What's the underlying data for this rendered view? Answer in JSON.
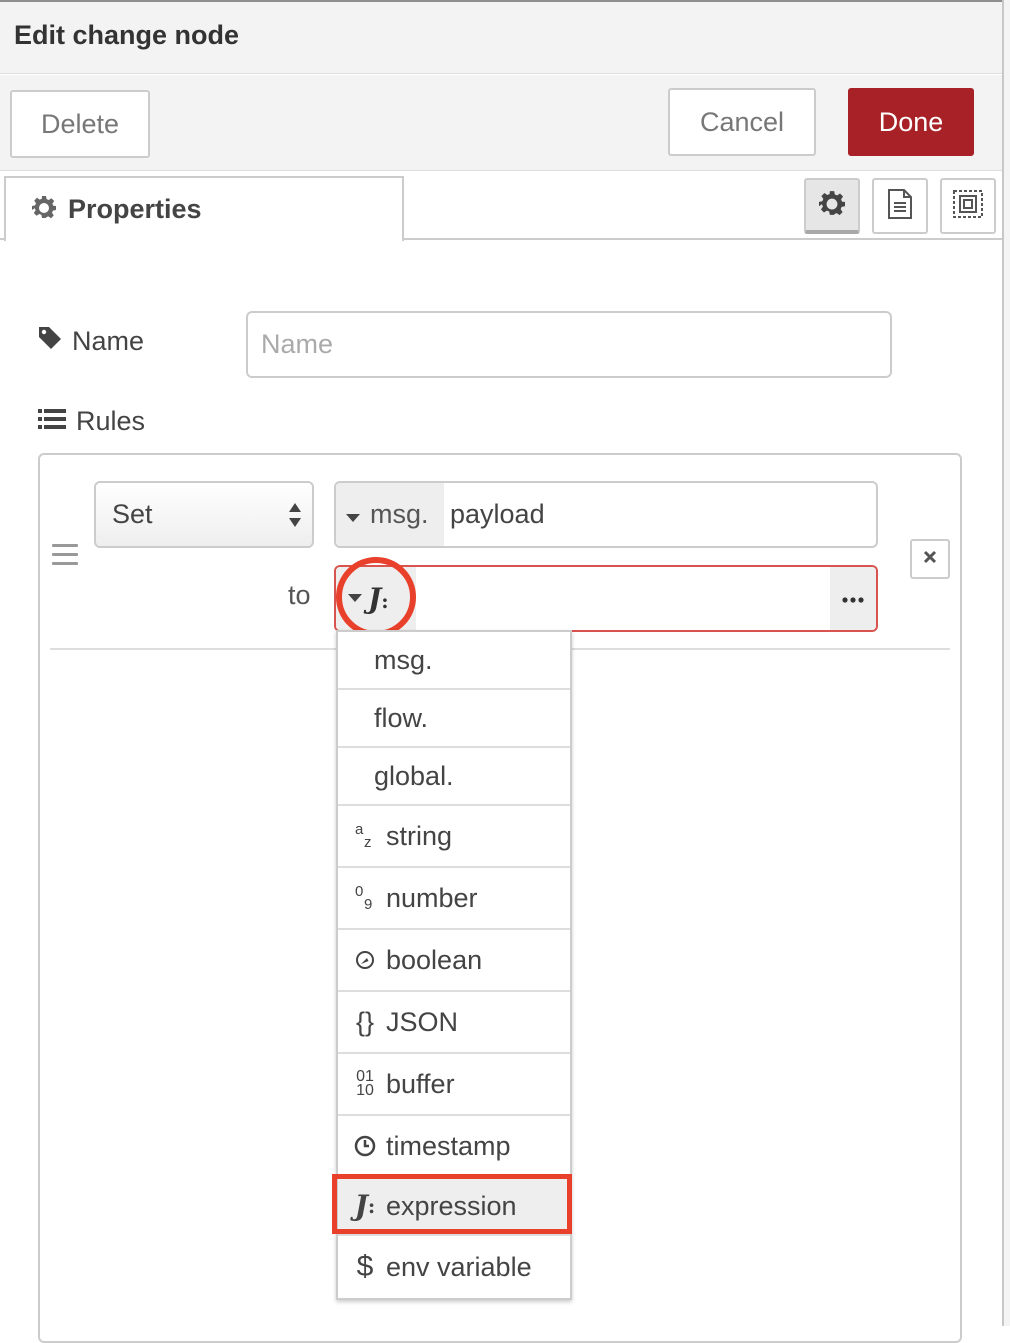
{
  "header": {
    "title": "Edit change node"
  },
  "toolbar": {
    "delete_label": "Delete",
    "cancel_label": "Cancel",
    "done_label": "Done"
  },
  "tabs": {
    "properties_label": "Properties"
  },
  "form": {
    "name_label": "Name",
    "name_placeholder": "Name",
    "name_value": "",
    "rules_label": "Rules"
  },
  "rule": {
    "action": "Set",
    "target_type": "msg.",
    "target_value": "payload",
    "to_label": "to",
    "to_value": ""
  },
  "dropdown": {
    "items": [
      {
        "label": "msg.",
        "icon": ""
      },
      {
        "label": "flow.",
        "icon": ""
      },
      {
        "label": "global.",
        "icon": ""
      },
      {
        "label": "string",
        "icon": "string-icon"
      },
      {
        "label": "number",
        "icon": "number-icon"
      },
      {
        "label": "boolean",
        "icon": "boolean-icon"
      },
      {
        "label": "JSON",
        "icon": "json-icon"
      },
      {
        "label": "buffer",
        "icon": "buffer-icon"
      },
      {
        "label": "timestamp",
        "icon": "clock-icon"
      },
      {
        "label": "expression",
        "icon": "jsonata-icon",
        "selected": true
      },
      {
        "label": "env variable",
        "icon": "dollar-icon"
      }
    ]
  },
  "colors": {
    "done_button": "#a82126",
    "highlight": "#e8402a",
    "error_border": "#d9534f"
  }
}
